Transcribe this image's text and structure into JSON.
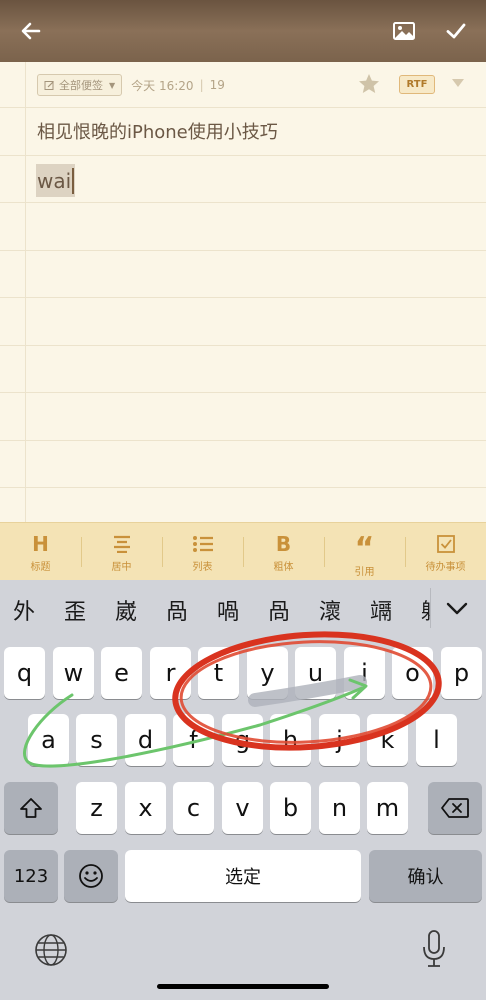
{
  "notes": {
    "folder_label": "全部便签",
    "timestamp": "今天 16:20",
    "char_count": "19",
    "format_badge": "RTF",
    "title": "相见恨晚的iPhone使用小技巧",
    "composing_text": "wai"
  },
  "format_toolbar": [
    {
      "glyph": "H",
      "label": "标题"
    },
    {
      "glyph": "",
      "label": "居中"
    },
    {
      "glyph": "",
      "label": "列表"
    },
    {
      "glyph": "B",
      "label": "粗体"
    },
    {
      "glyph": "“",
      "label": "引用"
    },
    {
      "glyph": "",
      "label": "待办事项"
    }
  ],
  "keyboard": {
    "candidates": [
      "外",
      "歪",
      "崴",
      "咼",
      "喎",
      "咼",
      "瀤",
      "竵",
      "躰"
    ],
    "row1": [
      "q",
      "w",
      "e",
      "r",
      "t",
      "y",
      "u",
      "i",
      "o",
      "p"
    ],
    "row2": [
      "a",
      "s",
      "d",
      "f",
      "g",
      "h",
      "j",
      "k",
      "l"
    ],
    "row3": [
      "z",
      "x",
      "c",
      "v",
      "b",
      "n",
      "m"
    ],
    "numbers_label": "123",
    "space_label": "选定",
    "return_label": "确认"
  },
  "colors": {
    "toolbar_brown": "#7b634c",
    "paper": "#fbf6e7",
    "accent_orange": "#c9913a",
    "annotation_red": "#d9331f",
    "annotation_green": "#6cc56c"
  },
  "icons": [
    "back-arrow-icon",
    "image-icon",
    "checkmark-icon",
    "star-icon",
    "dropdown-icon",
    "align-center-icon",
    "list-icon",
    "todo-checkbox-icon",
    "shift-icon",
    "delete-icon",
    "emoji-icon",
    "globe-icon",
    "microphone-icon",
    "chevron-down-icon"
  ]
}
